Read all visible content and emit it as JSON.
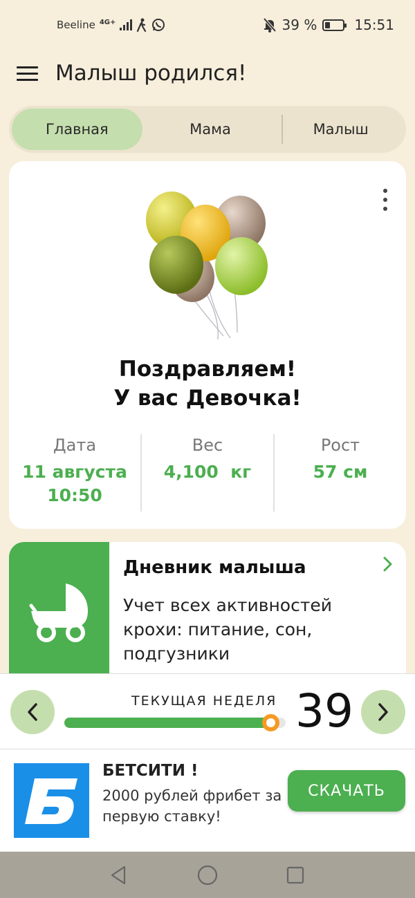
{
  "status_bar": {
    "carrier": "Beeline",
    "network": "4G+",
    "battery": "39 %",
    "battery_level": 0.39,
    "time": "15:51",
    "icons": [
      "signal-icon",
      "walk-icon",
      "whatsapp-icon",
      "mute-bell-icon",
      "battery-icon"
    ]
  },
  "app_bar": {
    "title": "Малыш родился!"
  },
  "tabs": [
    {
      "label": "Главная",
      "active": true
    },
    {
      "label": "Мама",
      "active": false
    },
    {
      "label": "Малыш",
      "active": false
    }
  ],
  "congrats_card": {
    "line1": "Поздравляем!",
    "line2": "У вас Девочка!",
    "stats": [
      {
        "label": "Дата",
        "value_line1": "11 августа",
        "value_line2": "10:50"
      },
      {
        "label": "Вес",
        "value_line1": "4,100  кг",
        "value_line2": ""
      },
      {
        "label": "Рост",
        "value_line1": "57 см",
        "value_line2": ""
      }
    ]
  },
  "diary_card": {
    "title": "Дневник малыша",
    "description": "Учет всех активностей крохи: питание, сон, подгузники",
    "icon": "stroller-icon"
  },
  "week_bar": {
    "label": "ТЕКУЩАЯ НЕДЕЛЯ",
    "week": "39",
    "progress": 0.93
  },
  "ad": {
    "title": "БЕТСИТИ !",
    "text": "2000 рублей фрибет за первую ставку!",
    "button": "СКАЧАТЬ",
    "logo_letter": "Б"
  },
  "colors": {
    "background": "#f7eedc",
    "accent_green": "#4caf50",
    "tab_active": "#c5deae",
    "knob_orange": "#f59a23",
    "ad_blue": "#1a8fe8"
  }
}
